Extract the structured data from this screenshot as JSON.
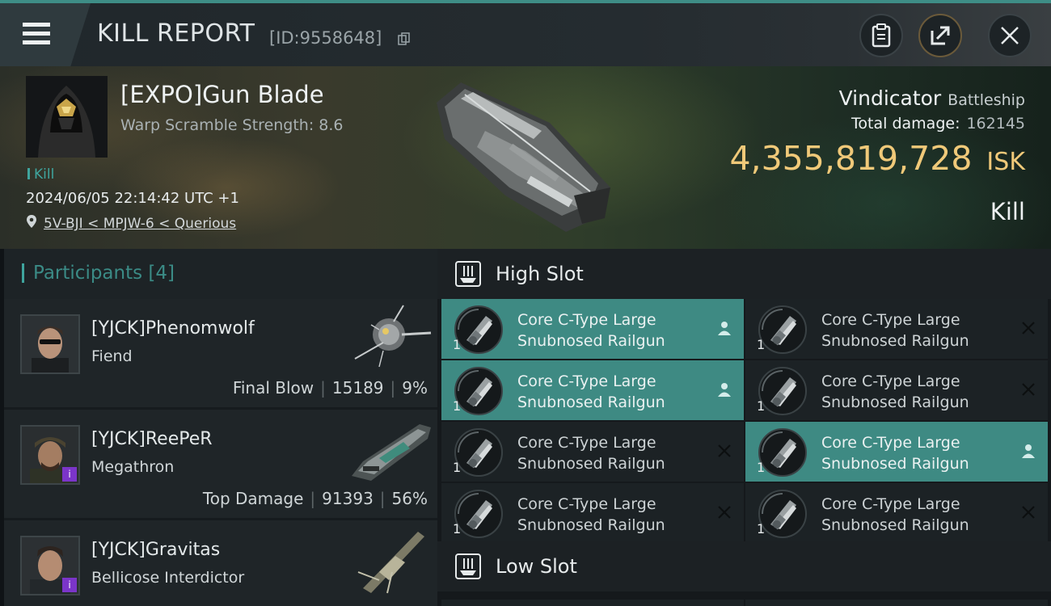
{
  "header": {
    "title": "KILL REPORT",
    "report_id": "[ID:9558648]"
  },
  "victim": {
    "name": "[EXPO]Gun Blade",
    "warp_scramble": "Warp Scramble Strength: 8.6",
    "tag": "Kill",
    "datetime": "2024/06/05 22:14:42 UTC +1",
    "location": "5V-BJI < MPJW-6 < Querious",
    "ship_name": "Vindicator",
    "ship_class": "Battleship",
    "total_damage_label": "Total damage:",
    "total_damage": "162145",
    "isk_value": "4,355,819,728",
    "isk_unit": "ISK",
    "result": "Kill"
  },
  "participants": {
    "heading": "Participants [4]",
    "rows": [
      {
        "name": "[YJCK]Phenomwolf",
        "ship": "Fiend",
        "role": "Final Blow",
        "damage": "15189",
        "percent": "9%"
      },
      {
        "name": "[YJCK]ReePeR",
        "ship": "Megathron",
        "role": "Top Damage",
        "damage": "91393",
        "percent": "56%"
      },
      {
        "name": "[YJCK]Gravitas",
        "ship": "Bellicose Interdictor"
      }
    ]
  },
  "fitting": {
    "high_slot": "High Slot",
    "low_slot": "Low Slot",
    "modules": [
      {
        "line1": "Core C-Type Large",
        "line2": "Snubnosed Railgun",
        "qty": "1",
        "state": "dropped"
      },
      {
        "line1": "Core C-Type Large",
        "line2": "Snubnosed Railgun",
        "qty": "1",
        "state": "destroyed"
      },
      {
        "line1": "Core C-Type Large",
        "line2": "Snubnosed Railgun",
        "qty": "1",
        "state": "dropped"
      },
      {
        "line1": "Core C-Type Large",
        "line2": "Snubnosed Railgun",
        "qty": "1",
        "state": "destroyed"
      },
      {
        "line1": "Core C-Type Large",
        "line2": "Snubnosed Railgun",
        "qty": "1",
        "state": "destroyed"
      },
      {
        "line1": "Core C-Type Large",
        "line2": "Snubnosed Railgun",
        "qty": "1",
        "state": "dropped"
      },
      {
        "line1": "Core C-Type Large",
        "line2": "Snubnosed Railgun",
        "qty": "1",
        "state": "destroyed"
      },
      {
        "line1": "Core C-Type Large",
        "line2": "Snubnosed Railgun",
        "qty": "1",
        "state": "destroyed"
      }
    ]
  },
  "colors": {
    "accent": "#3e8a83",
    "isk": "#f0c979",
    "participants_heading": "#3b8b86",
    "implant_badge": "#7b35c9"
  },
  "icons": [
    "menu-icon",
    "copy-icon",
    "clipboard-icon",
    "share-icon",
    "close-icon",
    "location-pin-icon",
    "slot-icon",
    "pilot-icon",
    "destroyed-x-icon",
    "railgun-icon"
  ]
}
